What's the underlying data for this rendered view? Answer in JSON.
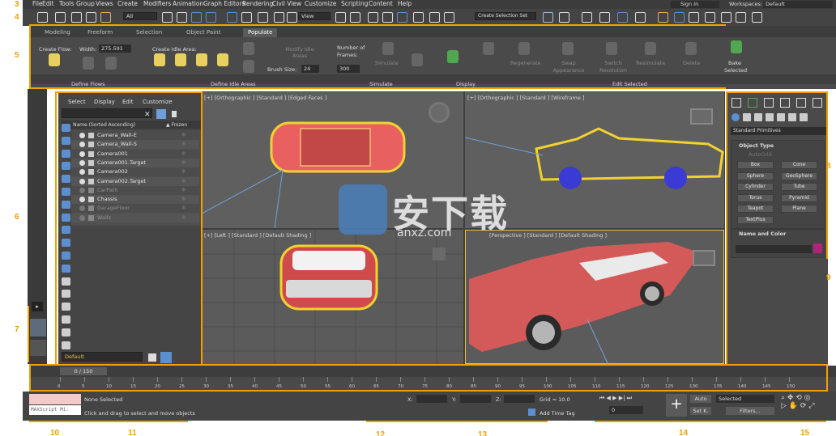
{
  "menu": [
    "File",
    "Edit",
    "Tools",
    "Group",
    "Views",
    "Create",
    "Modifiers",
    "Animation",
    "Graph Editors",
    "Rendering",
    "Civil View",
    "Customize",
    "Scripting",
    "Content",
    "Help"
  ],
  "signin": "Sign In",
  "workspaces_label": "Workspaces:",
  "workspace": "Default",
  "toolbar": {
    "filter": "All",
    "view": "View",
    "selection_set": "Create Selection Set"
  },
  "ribbon_tabs": [
    "Modeling",
    "Freeform",
    "Selection",
    "Object Paint",
    "Populate"
  ],
  "ribbon": {
    "create_flow": "Create Flow:",
    "width_label": "Width:",
    "width_value": "275.591",
    "create_idle": "Create Idle Area:",
    "modify_idle": "Modify Idle Areas",
    "brush_label": "Brush Size:",
    "brush_value": "24",
    "frames_label": "Number of Frames:",
    "frames_value": "300",
    "simulate": "Simulate",
    "regenerate": "Regenerate",
    "swap": "Swap Appearance",
    "switch": "Switch Resolution",
    "resimulate": "Resimulate",
    "delete": "Delete",
    "bake": "Bake Selected",
    "groups": [
      "Define Flows",
      "Define Idle Areas",
      "Simulate",
      "Display",
      "Edit Selected"
    ]
  },
  "scene": {
    "menu": [
      "Select",
      "Display",
      "Edit",
      "Customize"
    ],
    "col_name": "Name (Sorted Ascending)",
    "col_frozen": "▲ Frozen",
    "rows": [
      "Camera_Wall-E",
      "Camera_Wall-S",
      "Camera001",
      "Camera001.Target",
      "Camera002",
      "Camera002.Target",
      "CarPath",
      "Chassis",
      "GarageFloor",
      "Walls"
    ],
    "layer": "Default"
  },
  "viewports": {
    "top": "[+] [Orthographic ] [Standard ] [Edged Faces ]",
    "tr": "[+] [Orthographic ] [Standard ] [Wireframe ]",
    "left": "[+] [Left ] [Standard ] [Default Shading ]",
    "persp": "[Perspective ] [Standard ] [Default Shading ]"
  },
  "command": {
    "dropdown": "Standard Primitives",
    "rollout_type": "Object Type",
    "autogrid": "AutoGrid",
    "prims": [
      "Box",
      "Cone",
      "Sphere",
      "GeoSphere",
      "Cylinder",
      "Tube",
      "Torus",
      "Pyramid",
      "Teapot",
      "Plane",
      "TextPlus"
    ],
    "rollout_name": "Name and Color",
    "accent": "#b0247a"
  },
  "timeline": {
    "frame": "0 / 150",
    "ticks": [
      "0",
      "5",
      "10",
      "15",
      "20",
      "25",
      "30",
      "35",
      "40",
      "45",
      "50",
      "55",
      "60",
      "65",
      "70",
      "75",
      "80",
      "85",
      "90",
      "95",
      "100",
      "105",
      "110",
      "115",
      "120",
      "125",
      "130",
      "135",
      "140",
      "145",
      "150"
    ]
  },
  "status": {
    "maxscript": "MAXScript Mi:",
    "none_selected": "None Selected",
    "prompt": "Click and drag to select and move objects",
    "x": "X:",
    "y": "Y:",
    "z": "Z:",
    "grid": "Grid = 10.0",
    "add_time_tag": "Add Time Tag",
    "frame_field": "0",
    "auto": "Auto",
    "selected": "Selected",
    "setk": "Set K.",
    "filters": "Filters..."
  },
  "callouts": [
    "3",
    "4",
    "5",
    "6",
    "7",
    "8",
    "9",
    "10",
    "11",
    "12",
    "13",
    "14",
    "15"
  ],
  "watermark": {
    "cn": "安下载",
    "url": "anxz.com"
  }
}
